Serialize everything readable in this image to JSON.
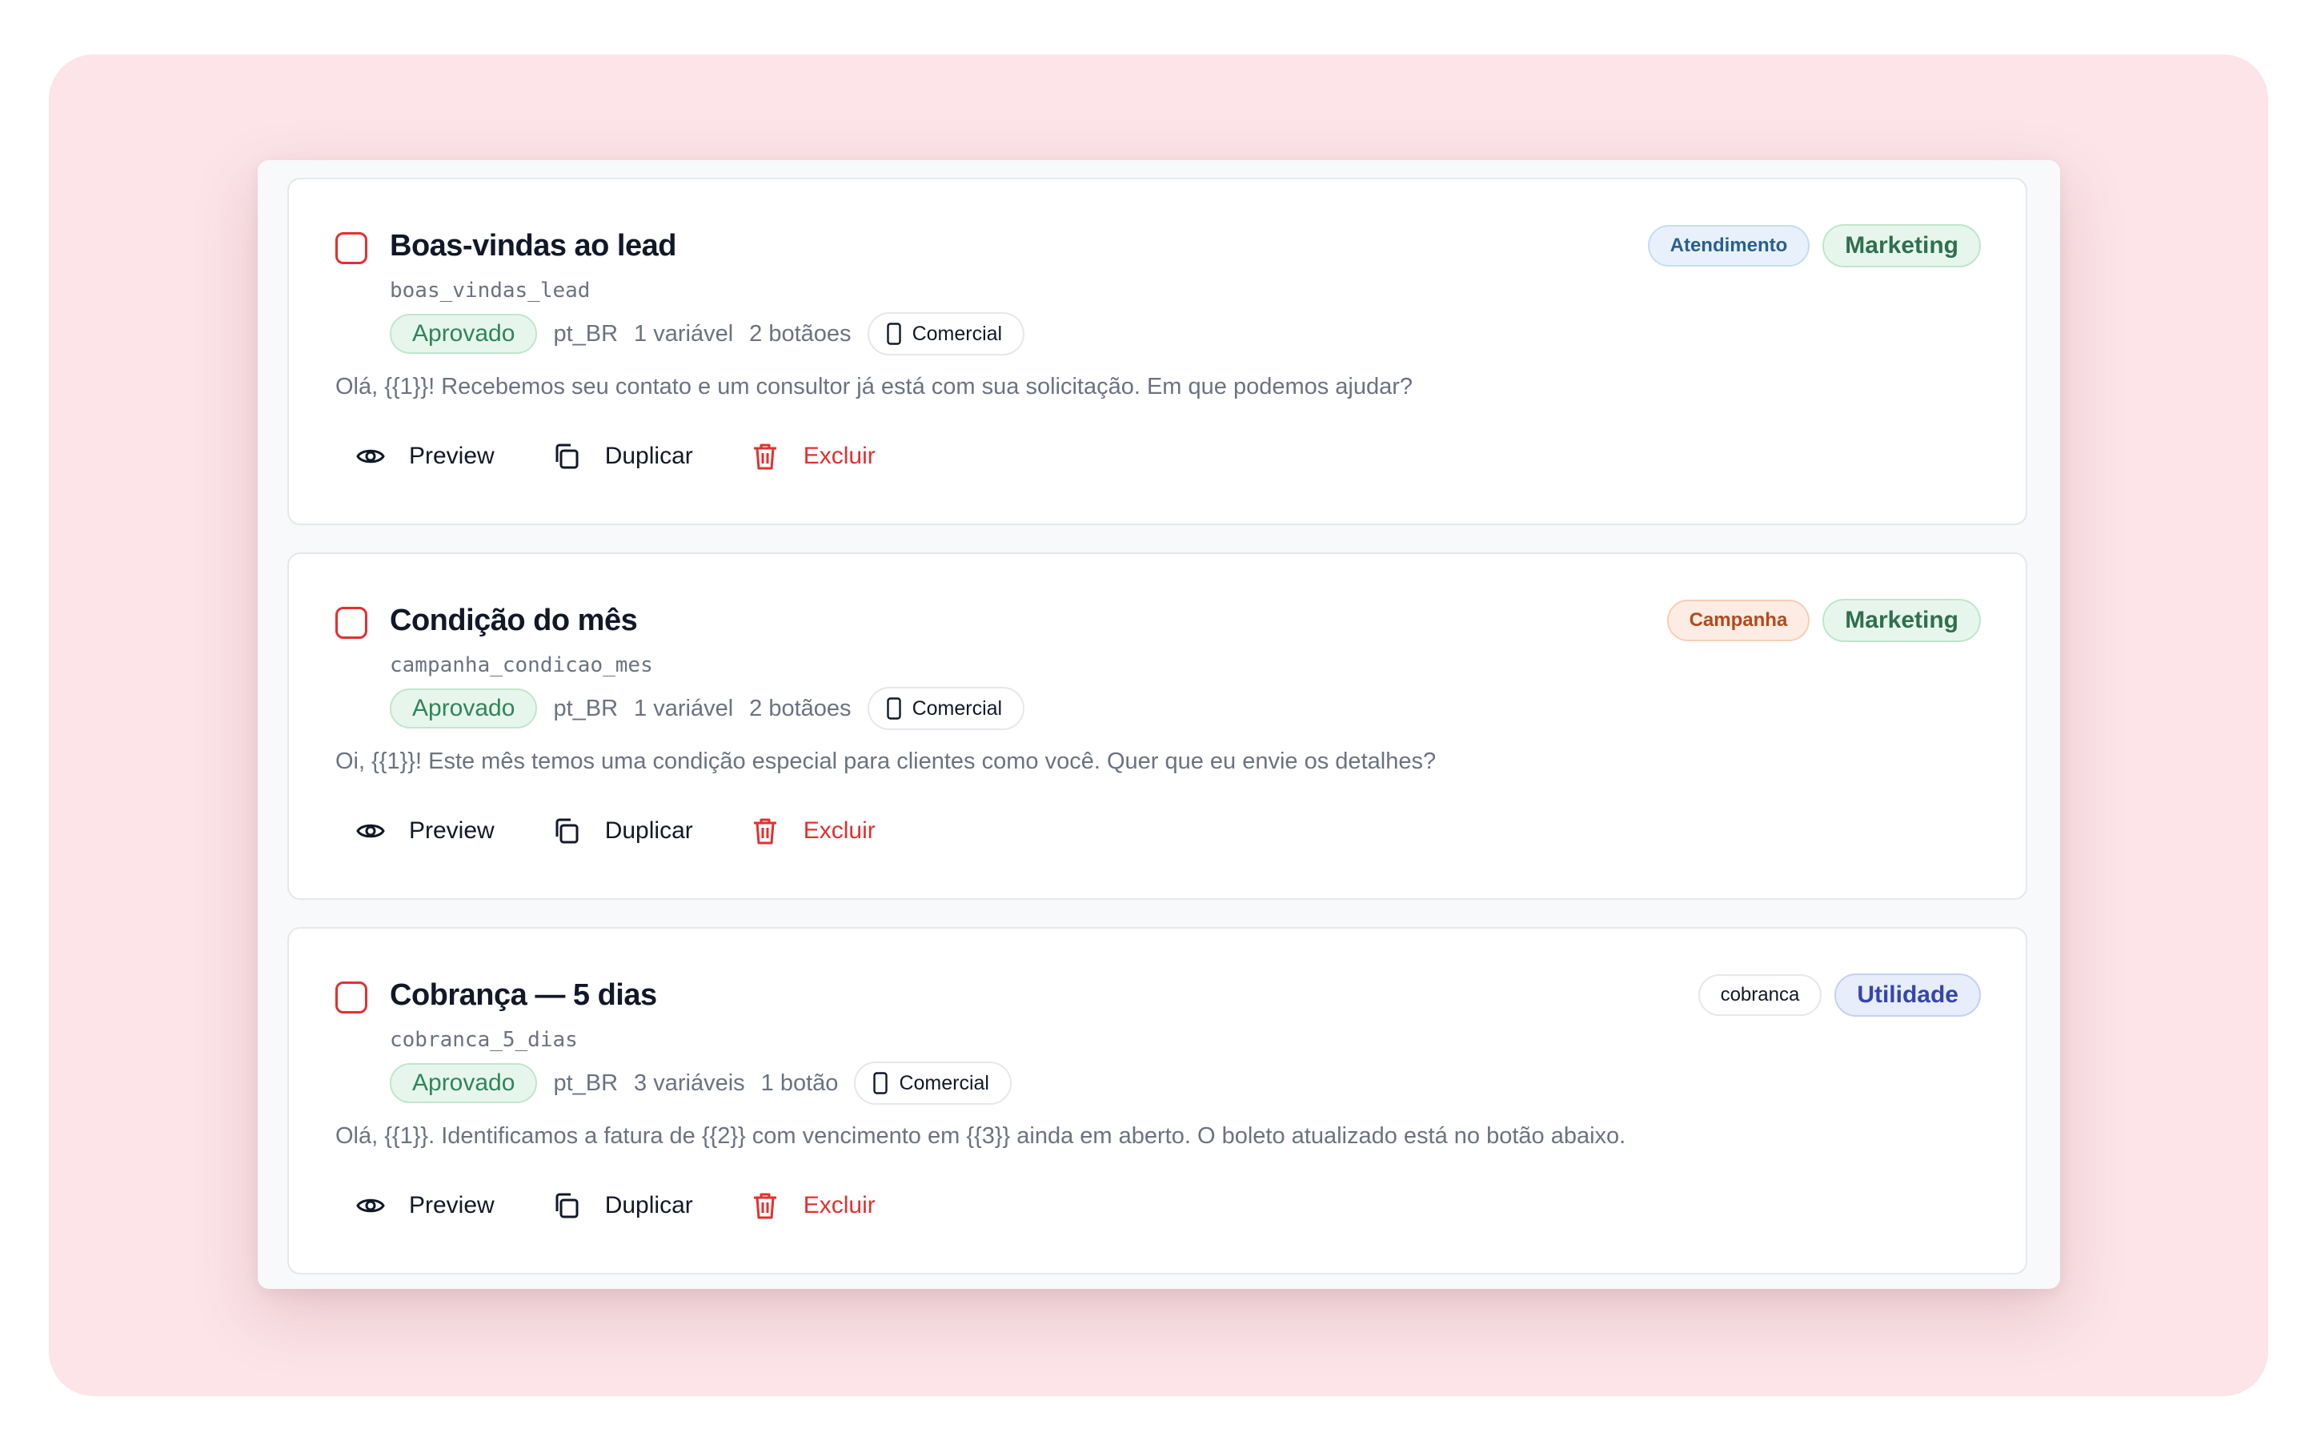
{
  "colors": {
    "backdrop": "#fce4e8",
    "danger": "#e03131",
    "approved": "#2f855a"
  },
  "actions": {
    "preview": "Preview",
    "duplicate": "Duplicar",
    "delete": "Excluir"
  },
  "templates": [
    {
      "title": "Boas-vindas ao lead",
      "slug": "boas_vindas_lead",
      "status": "Aprovado",
      "language": "pt_BR",
      "variables": "1 variável",
      "buttons": "2 botãoes",
      "channel": "Comercial",
      "body": "Olá, {{1}}! Recebemos seu contato e um consultor já está com sua solicitação. Em que podemos ajudar?",
      "tags": [
        {
          "label": "Atendimento",
          "color": "blue"
        },
        {
          "label": "Marketing",
          "color": "green"
        }
      ]
    },
    {
      "title": "Condição do mês",
      "slug": "campanha_condicao_mes",
      "status": "Aprovado",
      "language": "pt_BR",
      "variables": "1 variável",
      "buttons": "2 botãoes",
      "channel": "Comercial",
      "body": "Oi, {{1}}! Este mês temos uma condição especial para clientes como você. Quer que eu envie os detalhes?",
      "tags": [
        {
          "label": "Campanha",
          "color": "orange"
        },
        {
          "label": "Marketing",
          "color": "green"
        }
      ]
    },
    {
      "title": "Cobrança — 5 dias",
      "slug": "cobranca_5_dias",
      "status": "Aprovado",
      "language": "pt_BR",
      "variables": "3 variáveis",
      "buttons": "1 botão",
      "channel": "Comercial",
      "body": "Olá, {{1}}. Identificamos a fatura de {{2}} com vencimento em {{3}} ainda em aberto. O boleto atualizado está no botão abaixo.",
      "tags": [
        {
          "label": "cobranca",
          "color": "plain"
        },
        {
          "label": "Utilidade",
          "color": "indigo"
        }
      ]
    }
  ]
}
